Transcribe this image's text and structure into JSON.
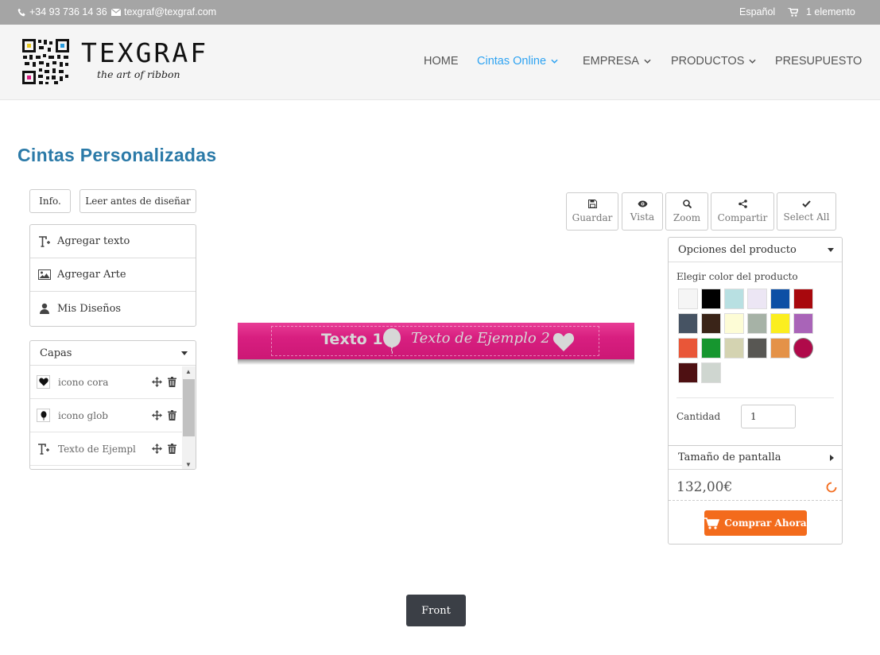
{
  "topbar": {
    "phone": "+34 93 736 14 36",
    "email": "texgraf@texgraf.com",
    "language": "Español",
    "cart": "1 elemento"
  },
  "header": {
    "brand_name": "TEXGRAF",
    "brand_tagline": "the art of ribbon",
    "nav": [
      {
        "label": "HOME",
        "active": false,
        "dropdown": false
      },
      {
        "label": "Cintas Online",
        "active": true,
        "dropdown": true
      },
      {
        "label": "EMPRESA",
        "active": false,
        "dropdown": true
      },
      {
        "label": "PRODUCTOS",
        "active": false,
        "dropdown": true
      },
      {
        "label": "PRESUPUESTO",
        "active": false,
        "dropdown": false
      }
    ]
  },
  "page": {
    "title": "Cintas Personalizadas"
  },
  "left": {
    "info_button": "Info.",
    "read_button": "Leer antes de diseñar",
    "menu": [
      {
        "label": "Agregar texto",
        "icon": "text-add-icon"
      },
      {
        "label": "Agregar Arte",
        "icon": "image-icon"
      },
      {
        "label": "Mis Diseños",
        "icon": "user-icon"
      }
    ],
    "layers_title": "Capas",
    "layers": [
      {
        "label": "icono cora",
        "icon": "heart-icon"
      },
      {
        "label": "icono glob",
        "icon": "balloon-icon"
      },
      {
        "label": "Texto de Ejempl",
        "icon": "text-icon"
      }
    ]
  },
  "canvas": {
    "ribbon_color": "#d81f80",
    "text1": "Texto 1",
    "text2": "Texto de Ejemplo 2"
  },
  "toolbar": [
    {
      "label": "Guardar",
      "icon": "save-icon"
    },
    {
      "label": "Vista",
      "icon": "eye-icon"
    },
    {
      "label": "Zoom",
      "icon": "zoom-icon"
    },
    {
      "label": "Compartir",
      "icon": "share-icon"
    },
    {
      "label": "Select All",
      "icon": "check-icon"
    }
  ],
  "options": {
    "title": "Opciones del producto",
    "color_label": "Elegir color del producto",
    "colors": [
      "#f5f5f5",
      "#000000",
      "#b8e0e2",
      "#ece6f4",
      "#0d4fa5",
      "#a8080d",
      "#465363",
      "#3a2418",
      "#fdfcd6",
      "#a6b2a6",
      "#fbee1f",
      "#a964b8",
      "#e95638",
      "#16962f",
      "#d4d3b1",
      "#585753",
      "#e49248",
      "#b00a4a",
      "#4e1012",
      "#cfd6d0"
    ],
    "selected_color": "#b00a4a",
    "qty_label": "Cantidad",
    "qty_value": "1",
    "size_title": "Tamaño de pantalla",
    "price": "132,00€",
    "buy_button": "Comprar Ahora"
  },
  "footer": {
    "front_button": "Front"
  },
  "colors": {
    "accent": "#2ea3f2",
    "title": "#2b7aa8",
    "buy": "#f36b1c"
  }
}
